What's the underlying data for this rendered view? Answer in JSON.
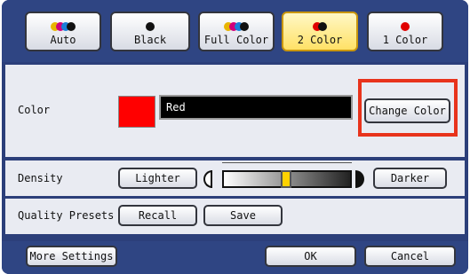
{
  "modes": [
    {
      "id": "auto",
      "label": "Auto",
      "dots": [
        "#e8b400",
        "#d0007a",
        "#1a7ed8",
        "#111111"
      ],
      "selected": false
    },
    {
      "id": "black",
      "label": "Black",
      "dots": [
        "#111111"
      ],
      "selected": false
    },
    {
      "id": "full",
      "label": "Full Color",
      "dots": [
        "#e8b400",
        "#d0007a",
        "#1a7ed8",
        "#111111"
      ],
      "selected": false
    },
    {
      "id": "two",
      "label": "2 Color",
      "dots": [
        "#e00000",
        "#111111"
      ],
      "selected": true
    },
    {
      "id": "one",
      "label": "1 Color",
      "dots": [
        "#e00000"
      ],
      "selected": false
    }
  ],
  "color_row": {
    "label": "Color",
    "swatch_color": "#ff0000",
    "value": "Red",
    "change_button": "Change Color"
  },
  "density_row": {
    "label": "Density",
    "lighter": "Lighter",
    "darker": "Darker",
    "level_percent": 45
  },
  "quality_row": {
    "label": "Quality Presets",
    "recall": "Recall",
    "save": "Save"
  },
  "footer": {
    "more_settings": "More Settings",
    "ok": "OK",
    "cancel": "Cancel"
  }
}
